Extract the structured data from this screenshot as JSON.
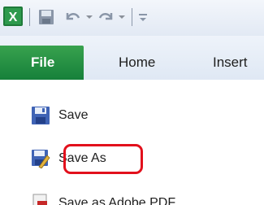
{
  "tabs": {
    "file": "File",
    "home": "Home",
    "insert": "Insert"
  },
  "menu": {
    "save": "Save",
    "save_as": "Save As",
    "save_as_pdf": "Save as Adobe PDF"
  },
  "icons": {
    "app": "excel-icon",
    "qat_save": "save-icon",
    "undo": "undo-icon",
    "redo": "redo-icon",
    "customize": "customize-qat-icon",
    "menu_save": "save-icon",
    "menu_save_as": "save-as-icon",
    "menu_pdf": "pdf-icon"
  },
  "colors": {
    "file_tab": "#218d43",
    "highlight": "#e2101c"
  }
}
